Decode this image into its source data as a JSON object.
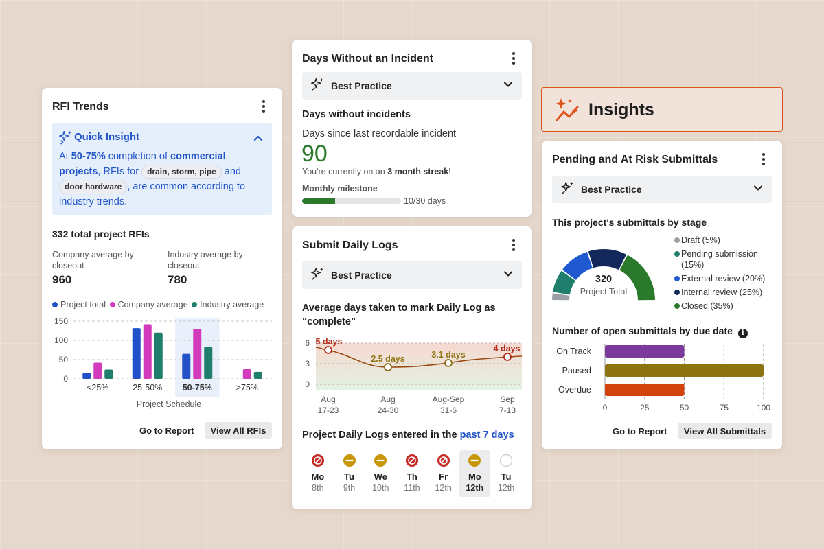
{
  "rfi": {
    "title": "RFI Trends",
    "insight_label": "Quick Insight",
    "insight_p1": "At ",
    "insight_b1": "50-75%",
    "insight_p2": " completion of ",
    "insight_b2": "commercial projects",
    "insight_p3": ", RFIs for ",
    "insight_pill1": "drain, storm, pipe",
    "insight_p4": " and ",
    "insight_pill2": "door hardware",
    "insight_p5": ", are common according to industry trends.",
    "total": "332 total project RFIs",
    "company_label": "Company average by closeout",
    "company_value": "960",
    "industry_label": "Industry average by closeout",
    "industry_value": "780",
    "legend": [
      "Project total",
      "Company average",
      "Industry average"
    ],
    "go_report": "Go to Report",
    "view_all": "View All RFIs"
  },
  "colors": {
    "project": "#2150c8",
    "company": "#d33bbd",
    "industry": "#1f7e6c",
    "accent_orange": "#e0531a",
    "green": "#2b7a2b"
  },
  "incident": {
    "title": "Days Without an Incident",
    "best_practice": "Best Practice",
    "subtitle": "Days without incidents",
    "since_label": "Days since last recordable incident",
    "days": "90",
    "streak_pre": "You're currently on an ",
    "streak_bold": "3 month streak",
    "streak_post": "!",
    "milestone_label": "Monthly milestone",
    "milestone_text": "10/30 days",
    "milestone_progress": 0.333
  },
  "daily": {
    "title": "Submit Daily Logs",
    "best_practice": "Best Practice",
    "chart_title": "Average days taken to mark Daily Log as “complete”",
    "entered_pre": "Project Daily Logs entered in the ",
    "entered_link": "past 7 days",
    "days": [
      {
        "day": "Mo",
        "date": "8th",
        "status": "missed"
      },
      {
        "day": "Tu",
        "date": "9th",
        "status": "late"
      },
      {
        "day": "We",
        "date": "10th",
        "status": "late"
      },
      {
        "day": "Th",
        "date": "11th",
        "status": "missed"
      },
      {
        "day": "Fr",
        "date": "12th",
        "status": "missed"
      },
      {
        "day": "Mo",
        "date": "12th",
        "status": "late",
        "selected": true
      },
      {
        "day": "Tu",
        "date": "12th",
        "status": "empty"
      }
    ]
  },
  "insights": {
    "label": "Insights"
  },
  "submittals": {
    "title": "Pending and At Risk Submittals",
    "best_practice": "Best Practice",
    "by_stage": "This project's submittals by stage",
    "total": "320",
    "total_label": "Project Total",
    "stages": [
      {
        "label": "Draft (5%)",
        "pct": 5,
        "color": "#9ca0a6"
      },
      {
        "label": "Pending submission (15%)",
        "pct": 15,
        "color": "#1f7e6c"
      },
      {
        "label": "External review (20%)",
        "pct": 20,
        "color": "#2058d0"
      },
      {
        "label": "Internal review (25%)",
        "pct": 25,
        "color": "#12275a"
      },
      {
        "label": "Closed (35%)",
        "pct": 35,
        "color": "#2b7a2b"
      }
    ],
    "due_title": "Number of open submittals by due date",
    "go_report": "Go to Report",
    "view_all": "View All Submittals"
  },
  "chart_data": [
    {
      "type": "bar",
      "title": "",
      "xlabel": "Project Schedule",
      "ylabel": "",
      "categories": [
        "<25%",
        "25-50%",
        "50-75%",
        ">75%"
      ],
      "highlight": "50-75%",
      "ylim": [
        0,
        150
      ],
      "yticks": [
        0,
        50,
        100,
        150
      ],
      "series": [
        {
          "name": "Project total",
          "values": [
            15,
            132,
            65,
            0
          ]
        },
        {
          "name": "Company average",
          "values": [
            42,
            142,
            130,
            25
          ]
        },
        {
          "name": "Industry average",
          "values": [
            24,
            120,
            83,
            18
          ]
        }
      ]
    },
    {
      "type": "line",
      "title": "Average days taken to mark Daily Log as “complete”",
      "xlabel": "",
      "ylabel": "",
      "categories": [
        "Aug 17-23",
        "Aug 24-30",
        "Aug-Sep 31-6",
        "Sep 7-13"
      ],
      "ylim": [
        0,
        7
      ],
      "yticks": [
        0,
        3,
        6
      ],
      "series": [
        {
          "values": [
            5,
            2.5,
            3.1,
            4
          ],
          "labels": [
            "5 days",
            "2.5 days",
            "3.1 days",
            "4 days"
          ]
        }
      ]
    },
    {
      "type": "pie",
      "title": "This project's submittals by stage",
      "categories": [
        "Draft",
        "Pending submission",
        "External review",
        "Internal review",
        "Closed"
      ],
      "values": [
        5,
        15,
        20,
        25,
        35
      ],
      "total": 320
    },
    {
      "type": "bar",
      "orientation": "horizontal",
      "title": "Number of open submittals by due date",
      "categories": [
        "On Track",
        "Paused",
        "Overdue"
      ],
      "values": [
        50,
        100,
        50
      ],
      "colors": [
        "#7b3a9c",
        "#8e7410",
        "#d2430c"
      ],
      "xlim": [
        0,
        100
      ],
      "xticks": [
        0,
        25,
        50,
        75,
        100
      ]
    }
  ]
}
